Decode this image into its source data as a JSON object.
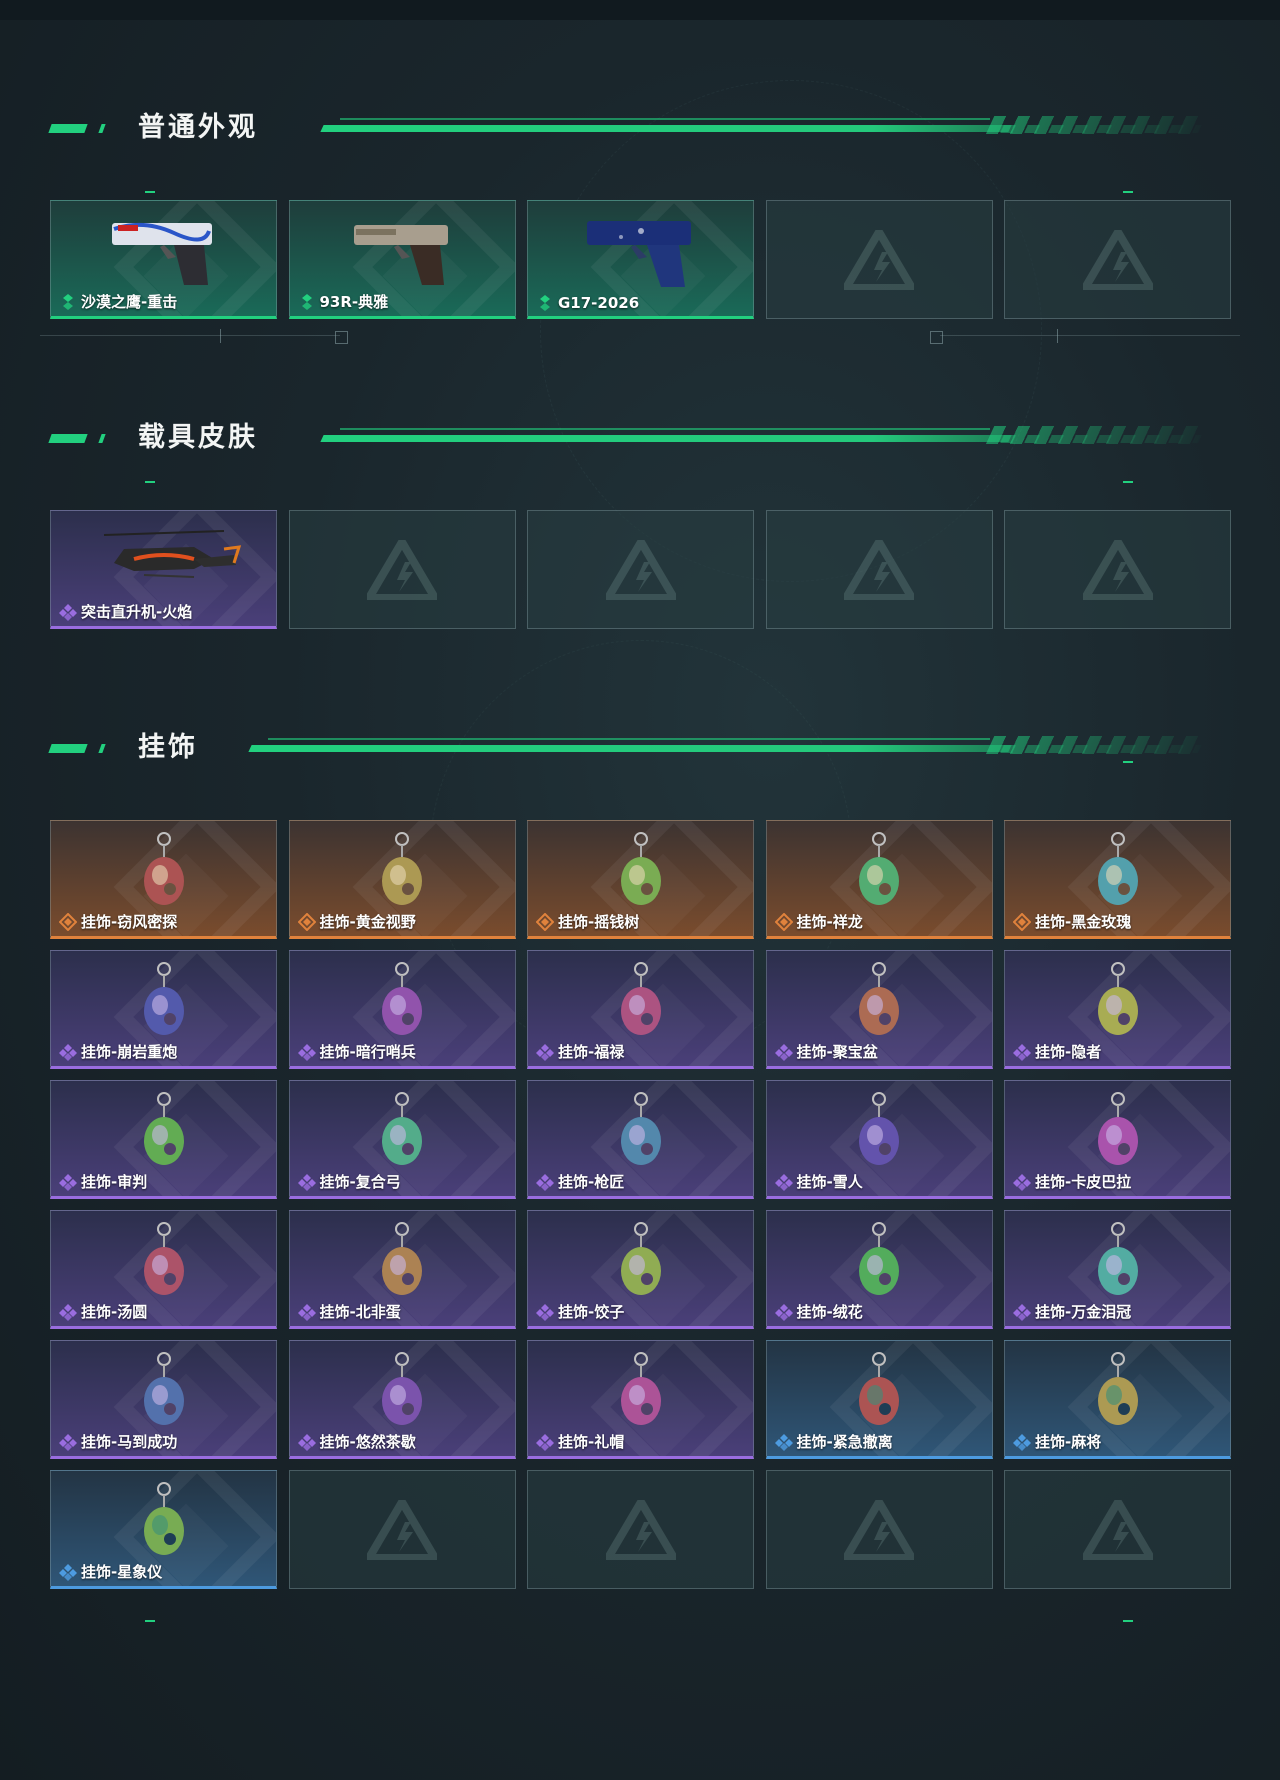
{
  "sections": [
    {
      "title": "普通外观",
      "items": [
        {
          "name": "沙漠之鹰-重击",
          "rarity": "green",
          "icon": "desert-eagle-pistol-icon"
        },
        {
          "name": "93R-典雅",
          "rarity": "green",
          "icon": "beretta-93r-pistol-icon"
        },
        {
          "name": "G17-2026",
          "rarity": "green",
          "icon": "glock-pistol-icon"
        },
        {
          "name": "",
          "rarity": "empty"
        },
        {
          "name": "",
          "rarity": "empty"
        }
      ]
    },
    {
      "title": "载具皮肤",
      "items": [
        {
          "name": "突击直升机-火焰",
          "rarity": "purple",
          "icon": "attack-helicopter-icon"
        },
        {
          "name": "",
          "rarity": "empty"
        },
        {
          "name": "",
          "rarity": "empty"
        },
        {
          "name": "",
          "rarity": "empty"
        },
        {
          "name": "",
          "rarity": "empty"
        }
      ]
    },
    {
      "title": "挂饰",
      "items": [
        {
          "name": "挂饰-窃风密探",
          "rarity": "orange",
          "icon": "charm-icon"
        },
        {
          "name": "挂饰-黄金视野",
          "rarity": "orange",
          "icon": "charm-icon"
        },
        {
          "name": "挂饰-摇钱树",
          "rarity": "orange",
          "icon": "charm-icon"
        },
        {
          "name": "挂饰-祥龙",
          "rarity": "orange",
          "icon": "charm-icon"
        },
        {
          "name": "挂饰-黑金玫瑰",
          "rarity": "orange",
          "icon": "charm-icon"
        },
        {
          "name": "挂饰-崩岩重炮",
          "rarity": "purple",
          "icon": "charm-icon"
        },
        {
          "name": "挂饰-暗行哨兵",
          "rarity": "purple",
          "icon": "charm-icon"
        },
        {
          "name": "挂饰-福禄",
          "rarity": "purple",
          "icon": "charm-icon"
        },
        {
          "name": "挂饰-聚宝盆",
          "rarity": "purple",
          "icon": "charm-icon"
        },
        {
          "name": "挂饰-隐者",
          "rarity": "purple",
          "icon": "charm-icon"
        },
        {
          "name": "挂饰-审判",
          "rarity": "purple",
          "icon": "charm-icon"
        },
        {
          "name": "挂饰-复合弓",
          "rarity": "purple",
          "icon": "charm-icon"
        },
        {
          "name": "挂饰-枪匠",
          "rarity": "purple",
          "icon": "charm-icon"
        },
        {
          "name": "挂饰-雪人",
          "rarity": "purple",
          "icon": "charm-icon"
        },
        {
          "name": "挂饰-卡皮巴拉",
          "rarity": "purple",
          "icon": "charm-icon"
        },
        {
          "name": "挂饰-汤圆",
          "rarity": "purple",
          "icon": "charm-icon"
        },
        {
          "name": "挂饰-北非蛋",
          "rarity": "purple",
          "icon": "charm-icon"
        },
        {
          "name": "挂饰-饺子",
          "rarity": "purple",
          "icon": "charm-icon"
        },
        {
          "name": "挂饰-绒花",
          "rarity": "purple",
          "icon": "charm-icon"
        },
        {
          "name": "挂饰-万金泪冠",
          "rarity": "purple",
          "icon": "charm-icon"
        },
        {
          "name": "挂饰-马到成功",
          "rarity": "purple",
          "icon": "charm-icon"
        },
        {
          "name": "挂饰-悠然茶歇",
          "rarity": "purple",
          "icon": "charm-icon"
        },
        {
          "name": "挂饰-礼帽",
          "rarity": "purple",
          "icon": "charm-icon"
        },
        {
          "name": "挂饰-紧急撤离",
          "rarity": "blue",
          "icon": "charm-icon"
        },
        {
          "name": "挂饰-麻将",
          "rarity": "blue",
          "icon": "charm-icon"
        },
        {
          "name": "挂饰-星象仪",
          "rarity": "blue",
          "icon": "charm-icon"
        },
        {
          "name": "",
          "rarity": "empty"
        },
        {
          "name": "",
          "rarity": "empty"
        },
        {
          "name": "",
          "rarity": "empty"
        },
        {
          "name": "",
          "rarity": "empty"
        }
      ]
    }
  ],
  "colors": {
    "accent": "#22d07f",
    "green": "#22d07f",
    "purple": "#9a6de0",
    "orange": "#e0823c",
    "blue": "#4d9be0"
  }
}
